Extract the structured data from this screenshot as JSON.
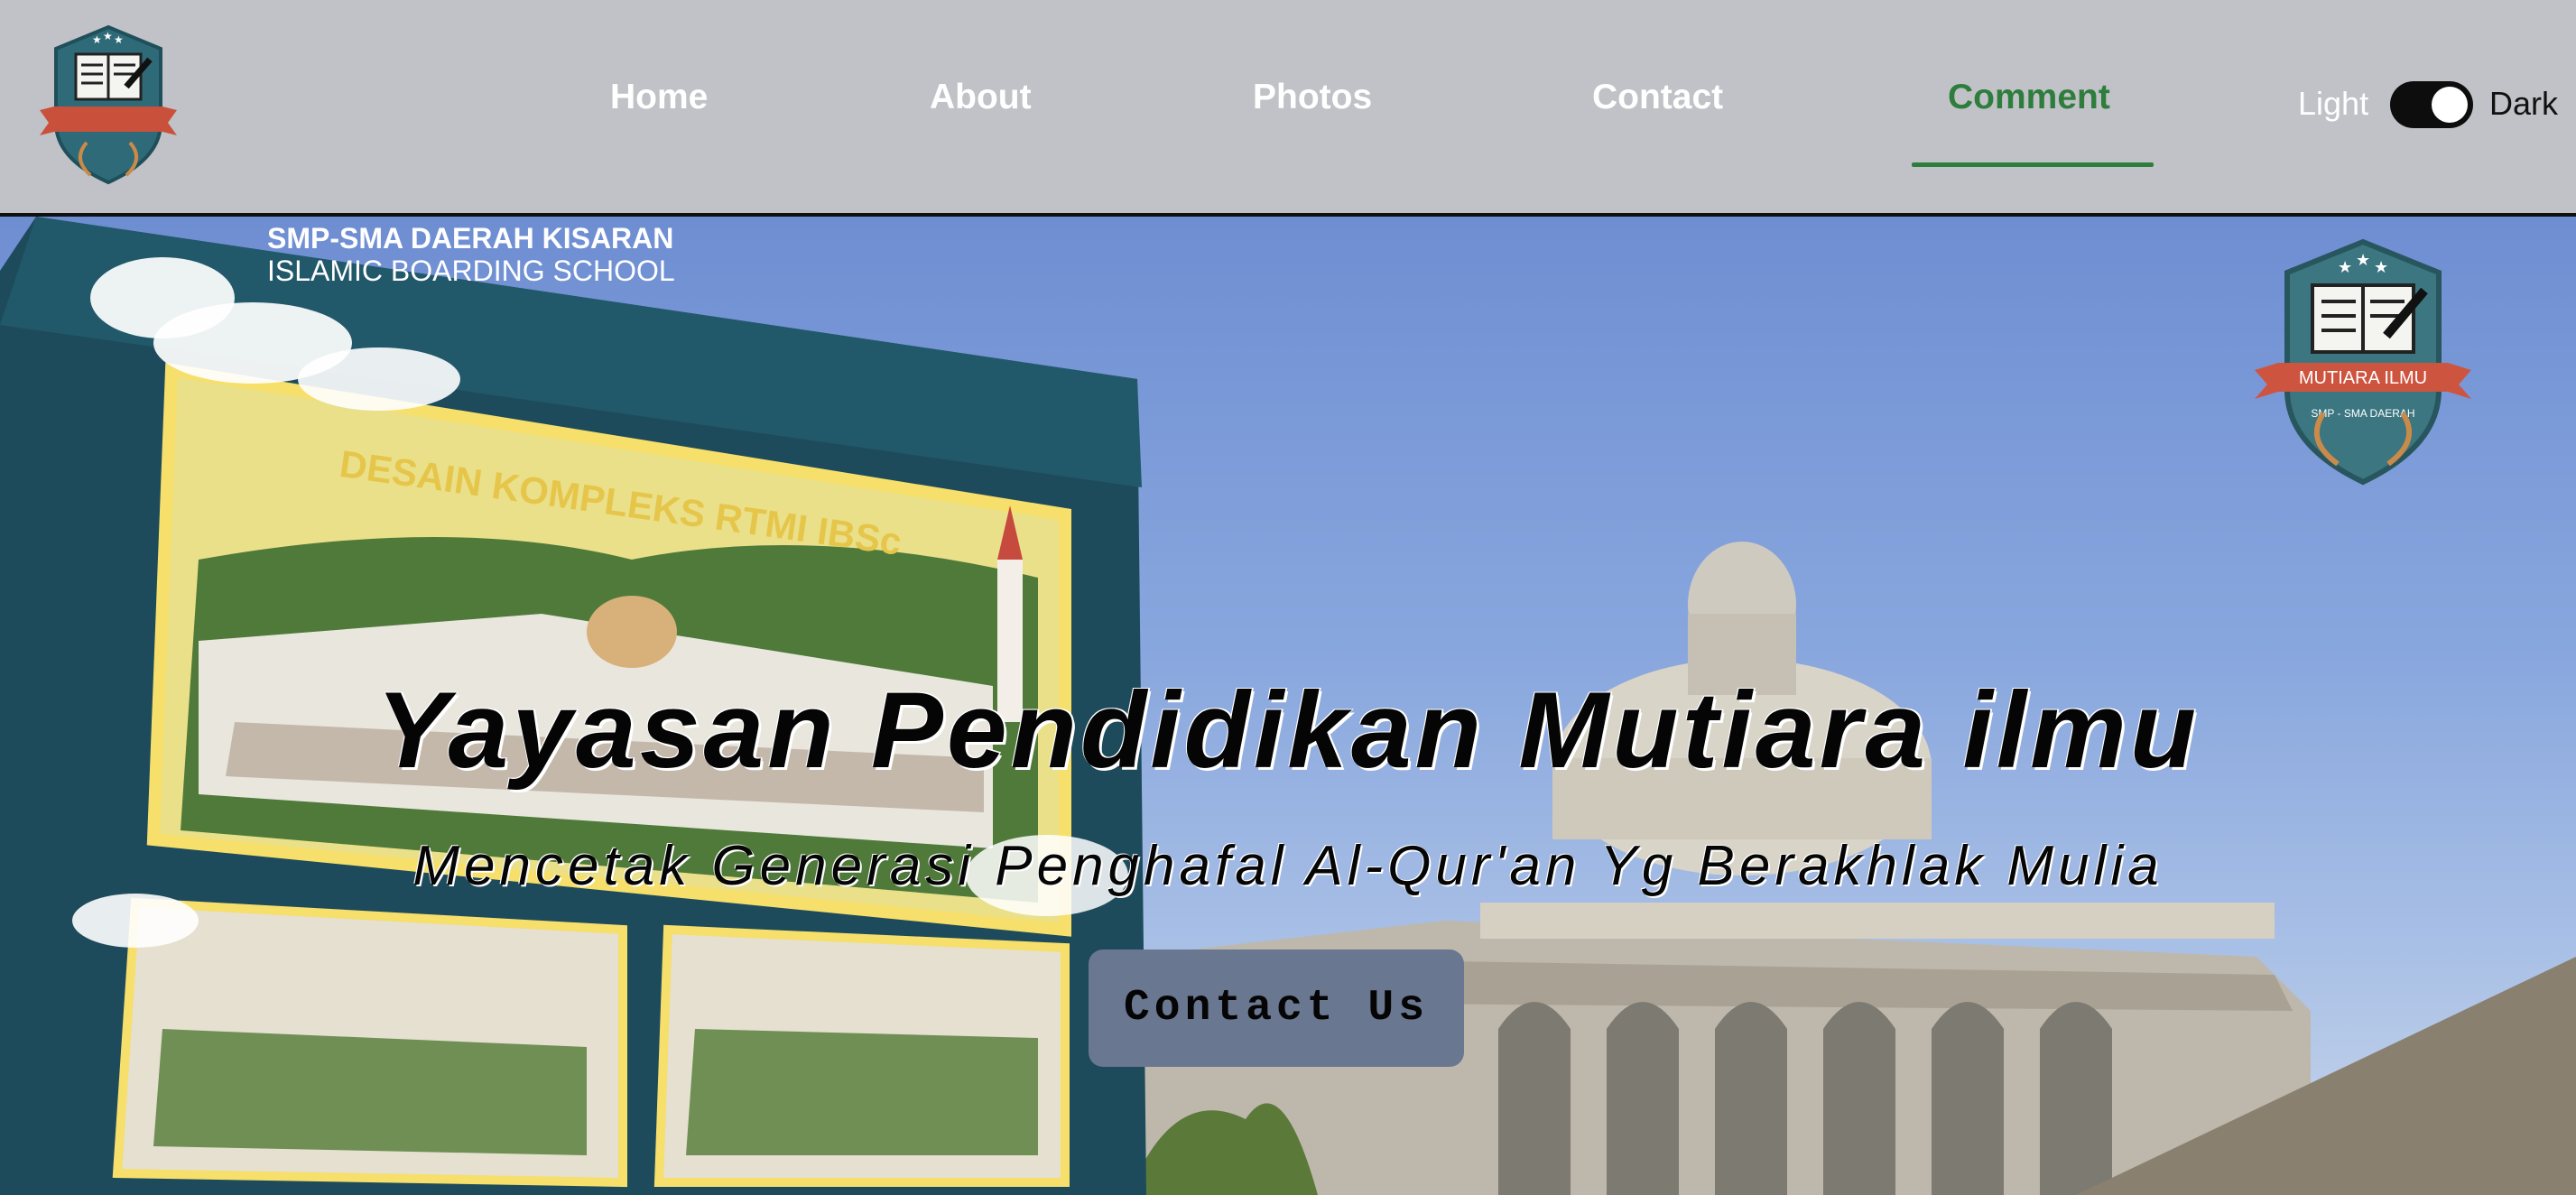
{
  "brand": {
    "logo_text": "MUTIARA ILMU",
    "logo_subtext": "SMP - SMA DAERAH"
  },
  "nav": {
    "items": [
      {
        "label": "Home"
      },
      {
        "label": "About"
      },
      {
        "label": "Photos"
      },
      {
        "label": "Contact"
      },
      {
        "label": "Comment",
        "active": true
      }
    ]
  },
  "theme": {
    "light_label": "Light",
    "dark_label": "Dark",
    "mode": "dark"
  },
  "hero": {
    "title": "Yayasan Pendidikan Mutiara ilmu",
    "subtitle": "Mencetak Generasi Penghafal Al-Qur'an Yg Berakhlak Mulia",
    "cta_label": "Contact Us",
    "billboard": {
      "school_line1": "SMP-SMA DAERAH KISARAN",
      "school_line2": "ISLAMIC BOARDING SCHOOL",
      "heading": "DESAIN KOMPLEKS RTMI IBSc"
    }
  },
  "colors": {
    "nav_bg": "#c0c2c7",
    "active": "#2f7d3c",
    "button": "#6a7790",
    "sky": "#89a7de"
  }
}
